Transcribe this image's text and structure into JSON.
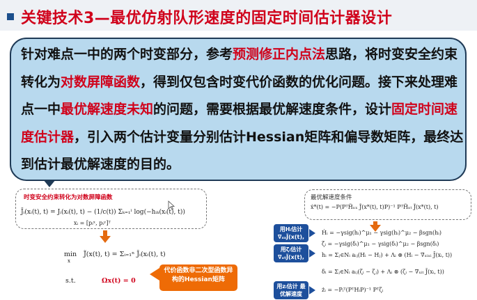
{
  "slide": {
    "title": "关键技术3—最优仿射队形速度的固定时间估计器设计"
  },
  "callout": {
    "segments": [
      {
        "text": "针对难点一中的两个时变部分，参考",
        "hl": false
      },
      {
        "text": "预测修正内点法",
        "hl": true
      },
      {
        "text": "思路，将时变安全约束转化为",
        "hl": false
      },
      {
        "text": "对数屏障函数",
        "hl": true
      },
      {
        "text": "，得到仅包含时变代价函数的优化问题。接下来处理难点一中",
        "hl": false
      },
      {
        "text": "最优解速度未知",
        "hl": true
      },
      {
        "text": "的问题，需要根据最优解速度条件，设计",
        "hl": false
      },
      {
        "text": "固定时间速度估计器",
        "hl": true
      },
      {
        "text": "，引入两个估计变量分别估计Hessian矩阵和偏导数矩阵，最终达到估计最优解速度的目的。",
        "hl": false
      }
    ]
  },
  "left_panel": {
    "label": "时变安全约束转化为对数屏障函数",
    "eq_barrier": "J̄ᵢ(xᵢ(t), t) = Jᵢ(xᵢ(t), t) − (1/c(t)) Σₖ₌₁ˡ log(−hᵢₖ(xᵢ(t), t))",
    "eq_def": "xᵢ = [pᵢˣ, pᵢʸ]ᵀ",
    "eq_min_prefix": "min",
    "eq_min_sub": "x",
    "eq_min": "J̃(x(t), t) = Σᵢ₌₁ⁿ J̄ᵢ(xᵢ(t), t)",
    "st": "s.t.",
    "constraint": "Ωx(t) = 0",
    "note": "代价函数非二次型函数异构的Hessian矩阵"
  },
  "right_panel": {
    "label": "最优解速度条件",
    "eq_opt": "ẋ*(t) = −P(PᵀH̃ₓₓ J̃(x*(t), t)P)⁻¹ PᵀH̃ₓₜ J̃(x*(t), t)",
    "eq_h_dot": "Ḣᵢ = −γsig(hᵢ)^μ₁ − γsig(hᵢ)^μ₂ − βsgn(hᵢ)",
    "eq_zeta_dot": "ζ̇ᵢ = −γsig(δᵢ)^μ₁ − γsig(δᵢ)^μ₂ − βsgn(δᵢ)",
    "eq_h": "hᵢ = Σⱼ∈Nᵢ aᵢⱼ(Hᵢ − Hⱼ) + Λᵢ ⊗ (Hᵢ − ∇ₓᵢₓᵢ J̄(xᵢ, t))",
    "eq_delta": "δᵢ = Σⱼ∈Nᵢ aᵢⱼ(ζᵢ − ζⱼ) + Λᵢ ⊗ (ζᵢ − ∇ₓᵢₜ J̄(xᵢ, t))",
    "eq_z": "żᵢ = −Pᵢᵀ(PᵀHᵢP)⁻¹ Pᵀζᵢ",
    "tag1": "用Hᵢ估计 ∇ₓₓJ̃(x(t), t)",
    "tag2": "用ζᵢ估计 ∇ₓₜJ̃(x(t), t)",
    "tag3": "用zᵢ估计 最优解速度"
  },
  "colors": {
    "title_red": "#d0021b",
    "callout_bg": "#b8d9ee",
    "orange": "#ee6b06",
    "tag_blue": "#1d4f9c"
  },
  "icons": [
    "title-bullet-icon",
    "cursor-icon",
    "arrow-down-icon",
    "arrow-left-icon",
    "arrow-right-icon"
  ]
}
